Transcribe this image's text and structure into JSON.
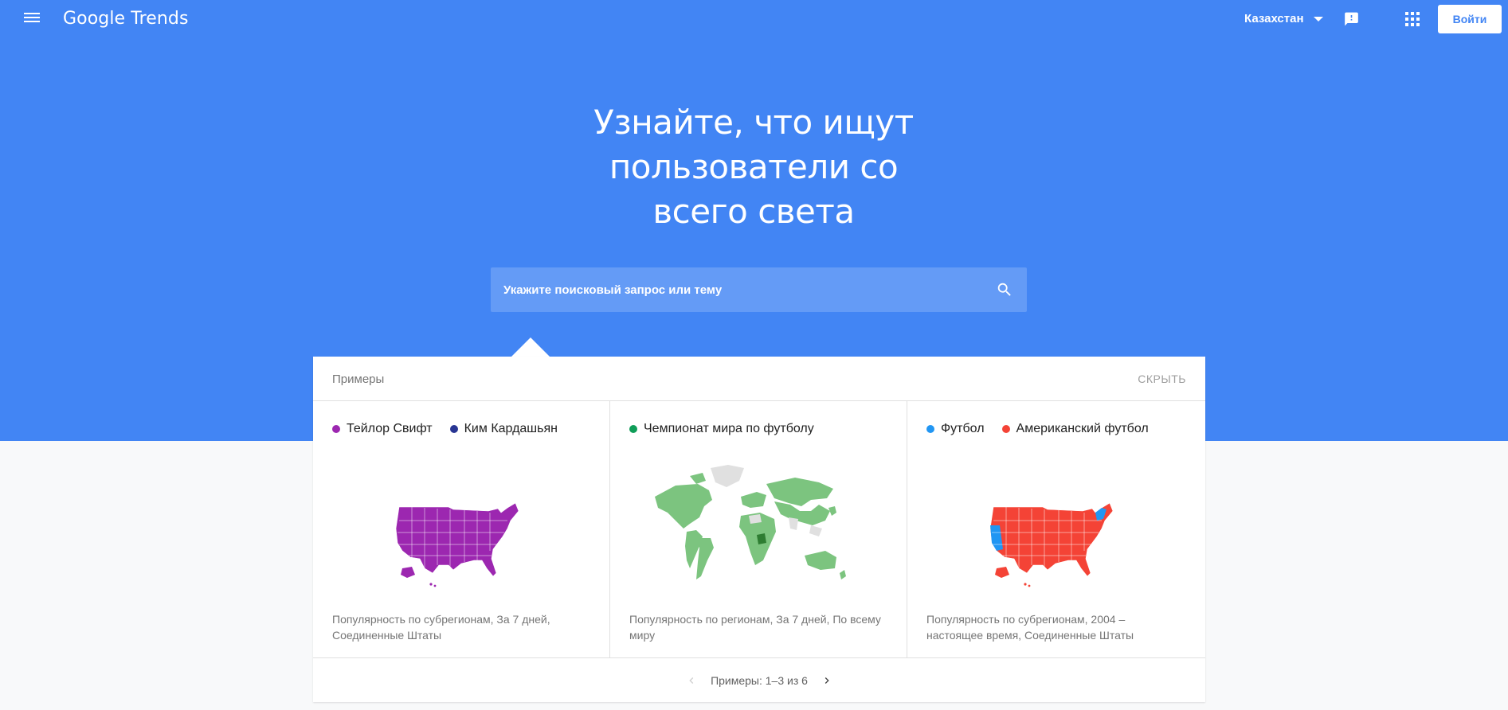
{
  "header": {
    "logo_text": "Google Trends",
    "country": "Казахстан",
    "signin_label": "Войти"
  },
  "hero": {
    "headline_line1": "Узнайте, что ищут",
    "headline_line2": "пользователи со",
    "headline_line3": "всего света",
    "search_placeholder": "Укажите поисковый запрос или тему"
  },
  "examples": {
    "title": "Примеры",
    "hide_label": "СКРЫТЬ",
    "pager_text": "Примеры: 1–3 из 6",
    "cards": [
      {
        "terms": [
          {
            "label": "Тейлор Свифт",
            "color": "#9c27b0"
          },
          {
            "label": "Ким Кардашьян",
            "color": "#283593"
          }
        ],
        "map_type": "us-map",
        "map_color": "#9c27b0",
        "caption": "Популярность по субрегионам, За 7 дней, Соединенные Штаты"
      },
      {
        "terms": [
          {
            "label": "Чемпионат мира по футболу",
            "color": "#0f9d58"
          }
        ],
        "map_type": "world-map",
        "map_color": "#7cc47f",
        "caption": "Популярность по регионам, За 7 дней, По всему миру"
      },
      {
        "terms": [
          {
            "label": "Футбол",
            "color": "#2196f3"
          },
          {
            "label": "Американский футбол",
            "color": "#f44336"
          }
        ],
        "map_type": "us-map",
        "map_color": "#f44336",
        "caption": "Популярность по субрегионам, 2004 – настоящее время, Соединенные Штаты"
      }
    ]
  },
  "colors": {
    "brand_blue": "#4285f4",
    "page_bg": "#f8f9fa"
  }
}
